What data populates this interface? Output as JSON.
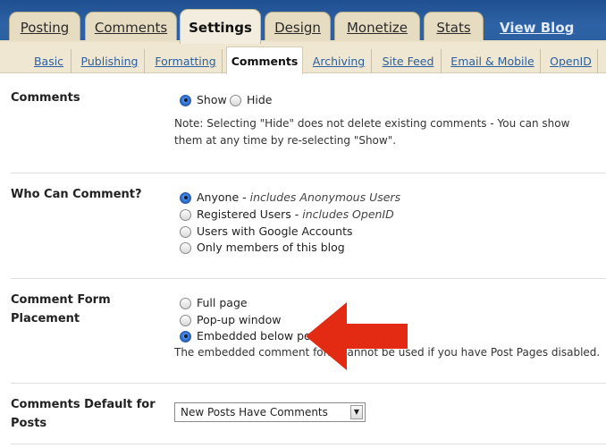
{
  "tabs": [
    {
      "label": "Posting",
      "active": false
    },
    {
      "label": "Comments",
      "active": false
    },
    {
      "label": "Settings",
      "active": true
    },
    {
      "label": "Design",
      "active": false
    },
    {
      "label": "Monetize",
      "active": false
    },
    {
      "label": "Stats",
      "active": false
    }
  ],
  "view_blog_label": "View Blog",
  "subtabs": [
    {
      "label": "Basic",
      "active": false
    },
    {
      "label": "Publishing",
      "active": false
    },
    {
      "label": "Formatting",
      "active": false
    },
    {
      "label": "Comments",
      "active": true
    },
    {
      "label": "Archiving",
      "active": false
    },
    {
      "label": "Site Feed",
      "active": false
    },
    {
      "label": "Email & Mobile",
      "active": false
    },
    {
      "label": "OpenID",
      "active": false
    }
  ],
  "comments": {
    "label": "Comments",
    "options": [
      "Show",
      "Hide"
    ],
    "selected": "Show",
    "note_line1": "Note: Selecting \"Hide\" does not delete existing comments - You can show",
    "note_line2": "them at any time by re-selecting \"Show\"."
  },
  "who_can_comment": {
    "label": "Who Can Comment?",
    "options": [
      {
        "label": "Anyone -",
        "detail": "includes Anonymous Users"
      },
      {
        "label": "Registered Users -",
        "detail": "includes OpenID"
      },
      {
        "label": "Users with Google Accounts",
        "detail": ""
      },
      {
        "label": "Only members of this blog",
        "detail": ""
      }
    ],
    "selected": "Anyone"
  },
  "comment_form_placement": {
    "label_line1": "Comment Form",
    "label_line2": "Placement",
    "options": [
      "Full page",
      "Pop-up window",
      "Embedded below post"
    ],
    "selected": "Embedded below post",
    "note": "The embedded comment form cannot be used if you have Post Pages disabled."
  },
  "comments_default": {
    "label_line1": "Comments Default for",
    "label_line2": "Posts",
    "value": "New Posts Have Comments"
  },
  "colors": {
    "header_blue": "#2b5fa0",
    "tab_beige": "#e6dcc2",
    "link_blue": "#2b5fa0",
    "annotation_red": "#e32a12"
  },
  "icons": {
    "annotation": "left-arrow-icon",
    "select_arrow": "dropdown-arrow-icon"
  }
}
